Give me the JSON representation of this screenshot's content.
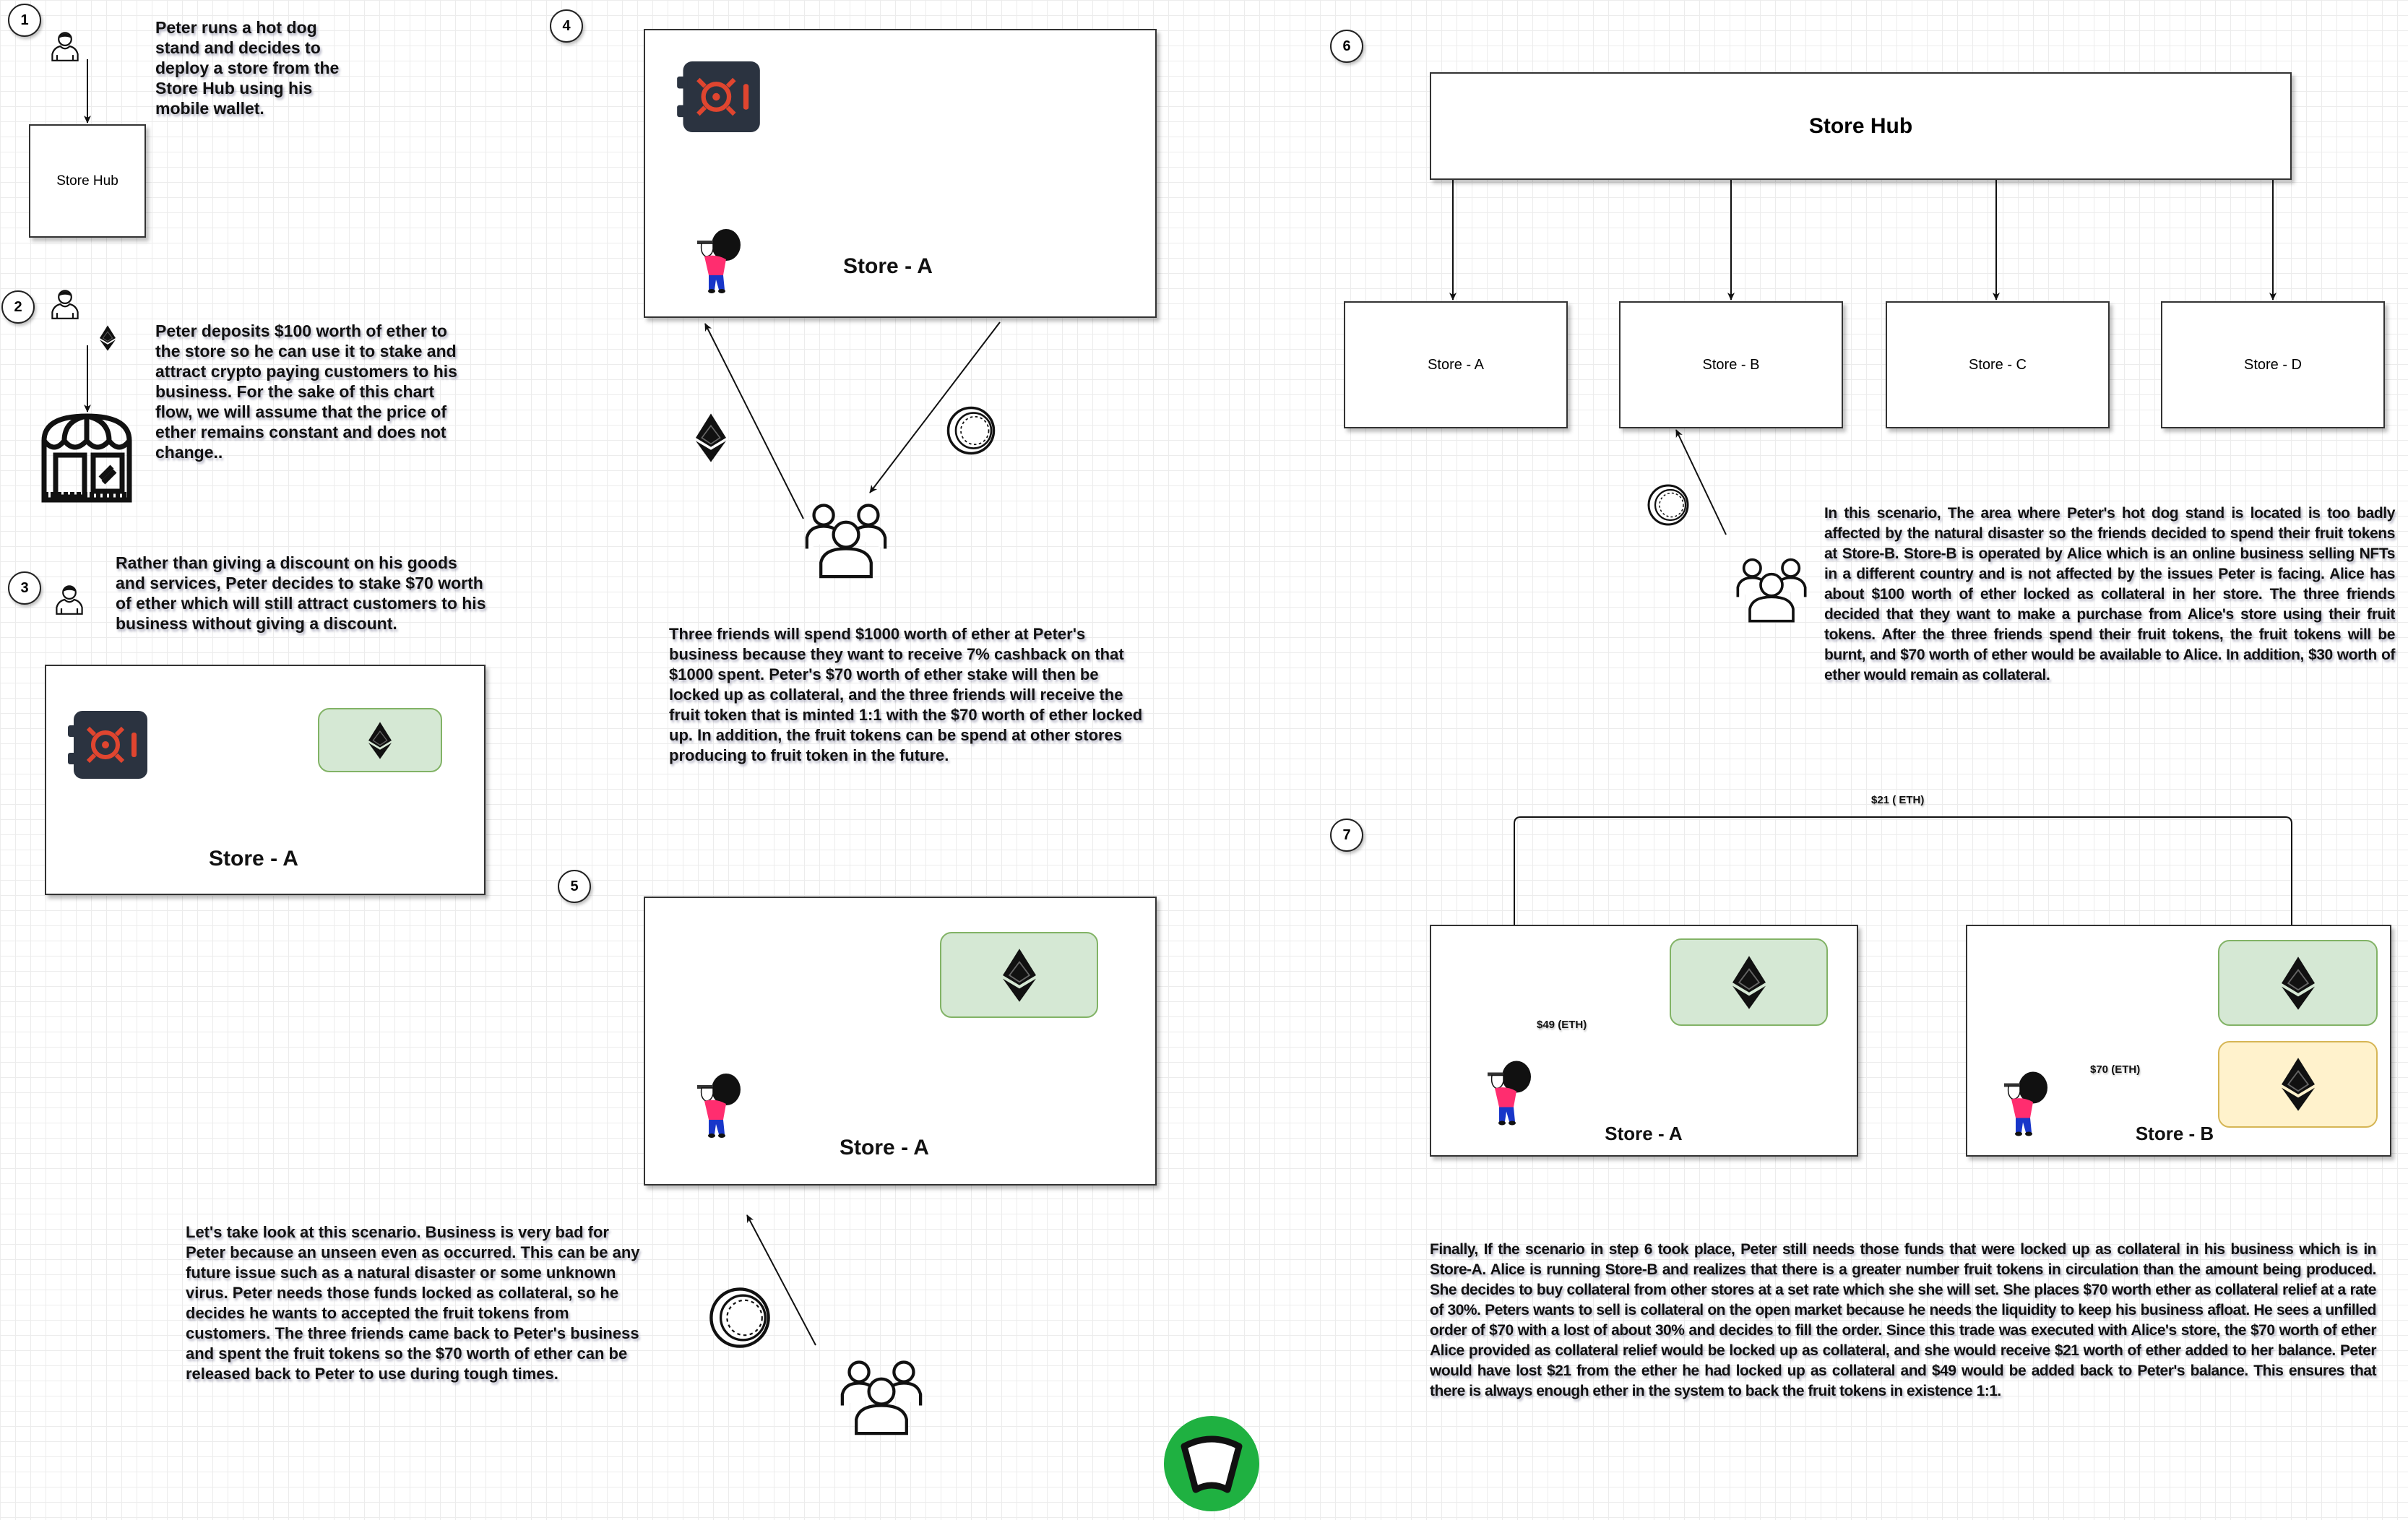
{
  "steps": [
    "1",
    "2",
    "3",
    "4",
    "5",
    "6",
    "7"
  ],
  "step1": {
    "box_label": "Store Hub",
    "text": "Peter runs a hot dog stand and decides to deploy a store from the Store Hub using his mobile wallet."
  },
  "step2": {
    "text": "Peter deposits $100 worth of ether to the store so he can use it to stake and attract crypto paying customers to his business. For the sake of this chart flow, we will assume that the price of ether remains constant and does not change.."
  },
  "step3": {
    "text": "Rather than giving a discount on his goods and services, Peter decides to stake $70 worth of ether which will still attract customers to his business without giving a discount.",
    "box_label": "Store - A"
  },
  "step4": {
    "box_label": "Store - A",
    "text": "Three friends will spend $1000 worth of ether at Peter's business because they want to receive 7% cashback on that $1000 spent. Peter's $70 worth of ether stake will then be locked up as collateral, and the three friends will receive the fruit token that is minted 1:1 with the $70 worth of ether locked up. In addition, the fruit tokens can be spend at other stores producing to fruit token in the future."
  },
  "step5": {
    "box_label": "Store - A",
    "text": "Let's take look at this scenario. Business is very bad for Peter because an unseen even as occurred. This can be any future issue such as a natural disaster or some unknown virus. Peter needs those funds locked as collateral, so he decides he wants to accepted the fruit tokens from customers. The three friends came back to Peter's business and spent the fruit tokens so the $70 worth of ether can be released back to Peter to use during tough times."
  },
  "step6": {
    "hub_label": "Store Hub",
    "stores": [
      "Store - A",
      "Store - B",
      "Store - C",
      "Store - D"
    ],
    "text": "In this scenario, The area where Peter's hot dog stand is located is too badly affected by the natural disaster so the friends decided to spend their fruit tokens at Store-B. Store-B is operated by Alice which is an online business selling NFTs in a different country and is not affected by the issues Peter is facing.  Alice has about $100 worth of ether locked as collateral in her store. The three friends decided that they want to make a purchase from Alice's store using their fruit tokens. After the three friends spend their fruit tokens, the fruit tokens will be burnt, and $70 worth of ether would be available to Alice. In addition, $30 worth of ether would remain as collateral."
  },
  "step7": {
    "store_a_label": "Store - A",
    "store_b_label": "Store - B",
    "transfer_label": "$21 ( ETH)",
    "peter_label": "$49 (ETH)",
    "release_label": "$70 (ETH)",
    "text": "Finally, If the scenario in step 6 took place, Peter still needs those funds that were locked up as collateral in his business which is in Store-A. Alice is running Store-B and realizes that there is a greater number fruit tokens in circulation than the amount being produced. She decides to buy collateral from other stores at a set rate which she she will set. She places $70 worth ether as collateral relief at a rate of 30%. Peters wants to sell is collateral on the open market because he needs the liquidity to keep his business afloat. He sees a unfilled order of $70 with a lost of about 30% and decides to fill the order. Since this trade was executed with Alice's store, the $70 worth of ether Alice provided as collateral relief would be locked up as collateral, and she would receive $21 worth of ether added to her balance. Peter would have lost $21 from the ether he had locked up as collateral and $49 would be added back to Peter's balance. This ensures that there is always enough ether in the system to back the fruit tokens in existence 1:1."
  },
  "icons": [
    "user-icon",
    "ethereum-icon",
    "storefront-icon",
    "vault-icon",
    "coin-icon",
    "group-icon",
    "peter-figure-icon",
    "logo-icon"
  ],
  "colors": {
    "collateral_green": "#d5e8d4",
    "collateral_green_border": "#82b366",
    "relief_yellow": "#fff2cc",
    "relief_yellow_border": "#d6b656",
    "vault_dark": "#2b3340",
    "vault_red": "#e0452f",
    "logo_green": "#1fb141"
  }
}
